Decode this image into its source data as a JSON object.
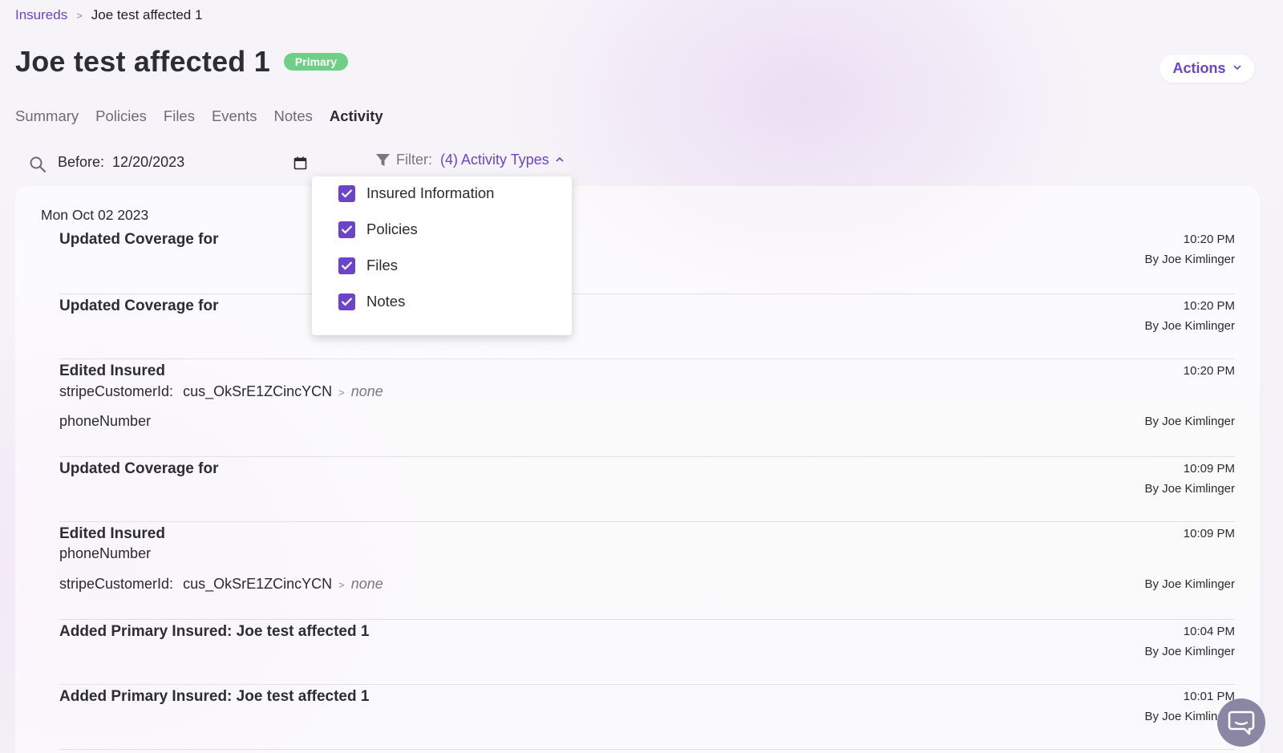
{
  "breadcrumb": {
    "root": "Insureds",
    "separator": ">",
    "current": "Joe test affected 1"
  },
  "header": {
    "title": "Joe test affected 1",
    "badge": "Primary",
    "actions_label": "Actions"
  },
  "tabs": [
    {
      "label": "Summary",
      "active": false
    },
    {
      "label": "Policies",
      "active": false
    },
    {
      "label": "Files",
      "active": false
    },
    {
      "label": "Events",
      "active": false
    },
    {
      "label": "Notes",
      "active": false
    },
    {
      "label": "Activity",
      "active": true
    }
  ],
  "filters": {
    "date_label": "Before:",
    "date_value": "12/20/2023",
    "filter_label": "Filter:",
    "filter_value": "(4) Activity Types"
  },
  "dropdown": {
    "items": [
      {
        "label": "Insured Information",
        "checked": true
      },
      {
        "label": "Policies",
        "checked": true
      },
      {
        "label": "Files",
        "checked": true
      },
      {
        "label": "Notes",
        "checked": true
      }
    ]
  },
  "activity": {
    "date_heading": "Mon Oct 02 2023",
    "entries": [
      {
        "title": "Updated Coverage for",
        "time": "10:20 PM",
        "by": "By Joe Kimlinger"
      },
      {
        "title": "Updated Coverage for",
        "time": "10:20 PM",
        "by": "By Joe Kimlinger"
      },
      {
        "title": "Edited Insured",
        "time": "10:20 PM",
        "by": "By Joe Kimlinger",
        "field1_name": "stripeCustomerId:",
        "field1_old": "cus_OkSrE1ZCincYCN",
        "field1_new": "none",
        "field2_name": "phoneNumber"
      },
      {
        "title": "Updated Coverage for",
        "time": "10:09 PM",
        "by": "By Joe Kimlinger"
      },
      {
        "title": "Edited Insured",
        "time": "10:09 PM",
        "by": "By Joe Kimlinger",
        "field1_name": "phoneNumber",
        "field2_name": "stripeCustomerId:",
        "field2_old": "cus_OkSrE1ZCincYCN",
        "field2_new": "none"
      },
      {
        "title": "Added Primary Insured: Joe test affected 1",
        "time": "10:04 PM",
        "by": "By Joe Kimlinger"
      },
      {
        "title": "Added Primary Insured: Joe test affected 1",
        "time": "10:01 PM",
        "by": "By Joe Kimlinger"
      }
    ]
  },
  "colors": {
    "accent": "#6b44c9",
    "badge": "#6fcf86",
    "chat": "#8a86a3"
  }
}
